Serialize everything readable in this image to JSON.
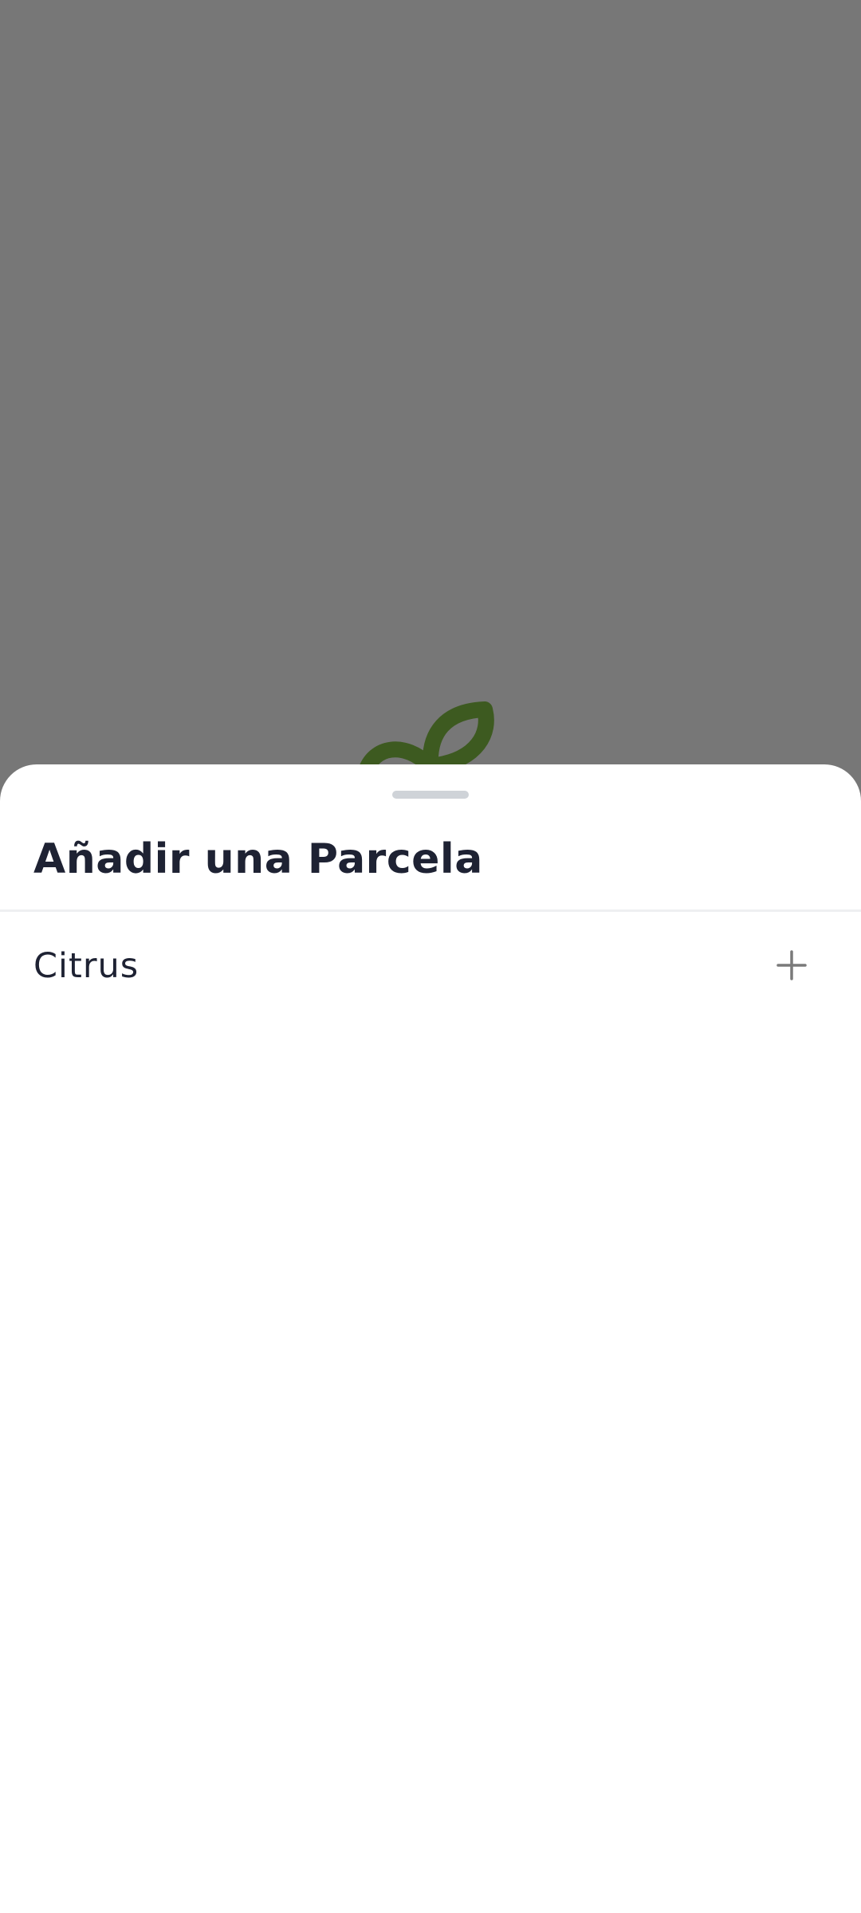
{
  "sheet": {
    "title": "Añadir una Parcela",
    "items": [
      {
        "label": "Citrus",
        "action_icon": "plus-icon"
      }
    ]
  },
  "colors": {
    "backdrop": "#777777",
    "sprout": "#3d5a20",
    "title_text": "#1e2233",
    "handle": "#cfd3d8",
    "plus_icon": "#7a7a7a"
  },
  "icons": {
    "background_logo": "sprout-icon",
    "item_action": "plus-icon"
  }
}
